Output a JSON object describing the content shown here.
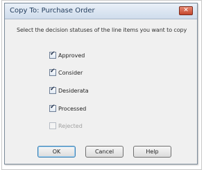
{
  "dialog": {
    "title": "Copy To: Purchase Order",
    "close_label": "✕",
    "instruction": "Select the decision statuses of the line items you want to copy"
  },
  "statuses": [
    {
      "label": "Approved",
      "checked": true,
      "enabled": true
    },
    {
      "label": "Consider",
      "checked": true,
      "enabled": true
    },
    {
      "label": "Desiderata",
      "checked": true,
      "enabled": true
    },
    {
      "label": "Processed",
      "checked": true,
      "enabled": true
    },
    {
      "label": "Rejected",
      "checked": false,
      "enabled": false
    }
  ],
  "buttons": {
    "ok": "OK",
    "cancel": "Cancel",
    "help": "Help"
  }
}
